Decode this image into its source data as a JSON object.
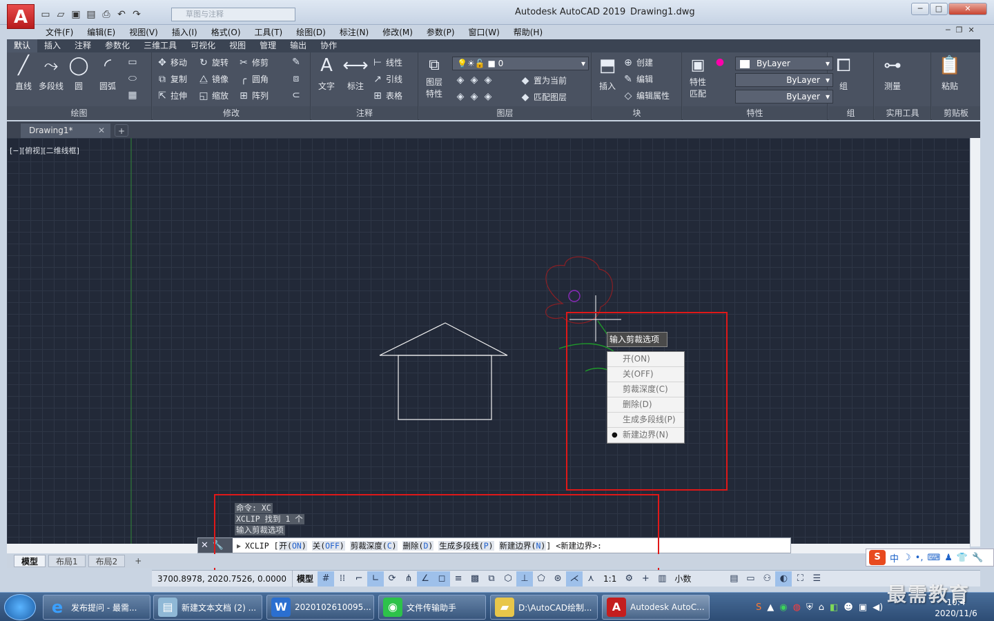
{
  "window": {
    "app_title": "Autodesk AutoCAD 2019",
    "doc_title": "Drawing1.dwg",
    "workspace": "草图与注释",
    "minimize": "─",
    "restore": "□",
    "close": "✕"
  },
  "menubar": [
    "文件(F)",
    "编辑(E)",
    "视图(V)",
    "插入(I)",
    "格式(O)",
    "工具(T)",
    "绘图(D)",
    "标注(N)",
    "修改(M)",
    "参数(P)",
    "窗口(W)",
    "帮助(H)"
  ],
  "ribbon_tabs": [
    "默认",
    "插入",
    "注释",
    "参数化",
    "三维工具",
    "可视化",
    "视图",
    "管理",
    "输出",
    "协作"
  ],
  "ribbon": {
    "draw": {
      "title": "绘图",
      "line": "直线",
      "polyline": "多段线",
      "circle": "圆",
      "arc": "圆弧"
    },
    "modify": {
      "title": "修改",
      "move": "移动",
      "rotate": "旋转",
      "trim": "修剪",
      "copy": "复制",
      "mirror": "镜像",
      "fillet": "圆角",
      "stretch": "拉伸",
      "scale": "缩放",
      "array": "阵列"
    },
    "annotation": {
      "title": "注释",
      "text": "文字",
      "dimension": "标注",
      "linear": "线性",
      "leader": "引线",
      "table": "表格"
    },
    "layers": {
      "title": "图层",
      "layer_props_1": "图层",
      "layer_props_2": "特性",
      "current_layer": "0",
      "set_current": "置为当前",
      "match_layer": "匹配图层"
    },
    "block": {
      "title": "块",
      "insert": "插入",
      "create": "创建",
      "edit": "编辑",
      "edit_attr": "编辑属性"
    },
    "properties": {
      "title": "特性",
      "match_1": "特性",
      "match_2": "匹配",
      "color": "ByLayer",
      "linetype": "ByLayer",
      "lineweight": "ByLayer"
    },
    "groups": {
      "title": "组",
      "group": "组"
    },
    "utilities": {
      "title": "实用工具",
      "measure": "测量"
    },
    "clipboard": {
      "title": "剪贴板",
      "paste": "粘贴"
    }
  },
  "file_tab": {
    "name": "Drawing1*"
  },
  "view_label": "[−][俯视][二维线框]",
  "context_menu": {
    "prompt": "输入剪裁选项",
    "items": [
      {
        "label": "开(ON)",
        "selected": false
      },
      {
        "label": "关(OFF)",
        "selected": false
      },
      {
        "label": "剪裁深度(C)",
        "selected": false
      },
      {
        "label": "删除(D)",
        "selected": false
      },
      {
        "label": "生成多段线(P)",
        "selected": false
      },
      {
        "label": "新建边界(N)",
        "selected": true
      }
    ]
  },
  "command_history": [
    "命令: XC",
    "XCLIP 找到 1 个",
    "输入剪裁选项"
  ],
  "command_line": {
    "cmd": "XCLIP",
    "options": [
      {
        "text": "开",
        "key": "ON"
      },
      {
        "text": "关",
        "key": "OFF"
      },
      {
        "text": "剪裁深度",
        "key": "C"
      },
      {
        "text": "删除",
        "key": "D"
      },
      {
        "text": "生成多段线",
        "key": "P"
      },
      {
        "text": "新建边界",
        "key": "N"
      }
    ],
    "default": "<新建边界>:"
  },
  "layout_tabs": [
    "模型",
    "布局1",
    "布局2"
  ],
  "status": {
    "coords": "3700.8978, 2020.7526, 0.0000",
    "model": "模型",
    "scale": "1:1",
    "units": "小数"
  },
  "ime": {
    "logo": "S",
    "mode": "中"
  },
  "taskbar": {
    "items": [
      "发布提问 - 最需...",
      "新建文本文档 (2) ...",
      "2020102610095...",
      "文件传输助手",
      "D:\\AutoCAD绘制...",
      "Autodesk AutoC..."
    ],
    "date": "2020/11/6",
    "time": "10:4",
    "watermark": "最需教育"
  },
  "colors": {
    "canvas": "#222938",
    "accent_red": "#e01818",
    "flower": "#8a1f24",
    "stem": "#1f9a2a"
  }
}
